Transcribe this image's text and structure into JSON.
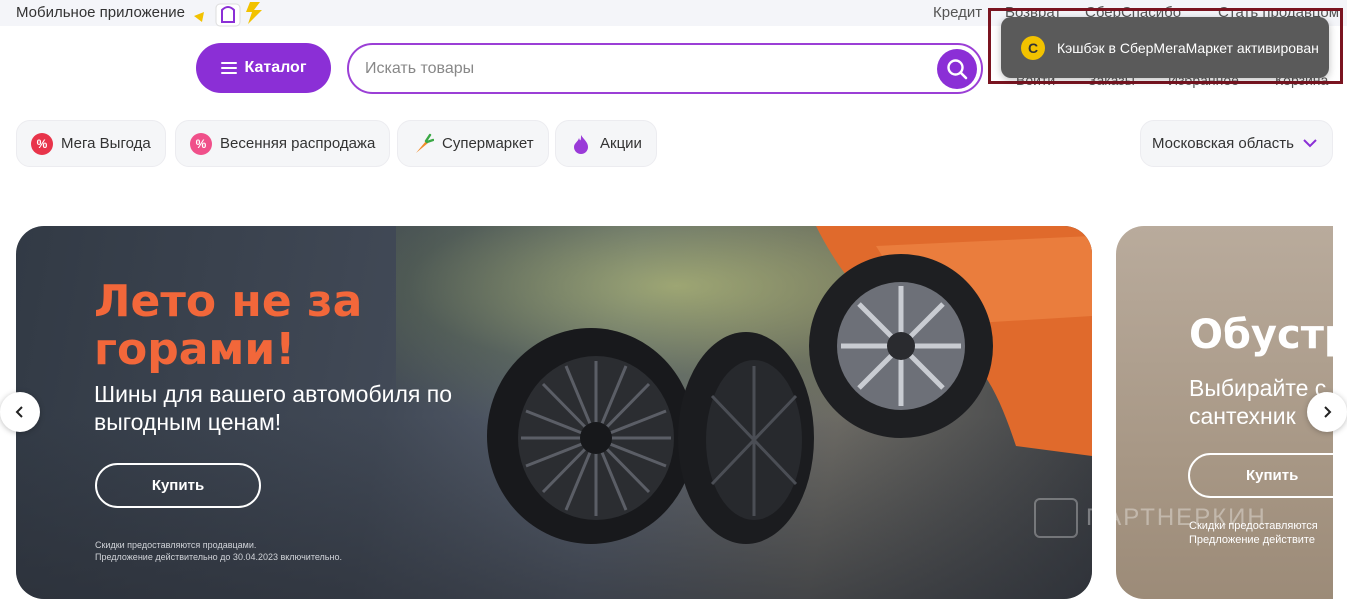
{
  "topbar": {
    "app_link": "Мобильное приложение",
    "credit": "Кредит",
    "faded_links": [
      "Возврат",
      "СберСпасибо",
      "Стать продавцом"
    ]
  },
  "header": {
    "catalog_label": "Каталог",
    "search_placeholder": "Искать товары",
    "nav": [
      "Войти",
      "Заказы",
      "Избранное",
      "Корзина"
    ]
  },
  "toast": {
    "coin": "С",
    "text": "Кэшбэк в СберМегаМаркет активирован"
  },
  "chips": [
    {
      "label": "Мега Выгода",
      "icon": "percent-icon",
      "color": "#e8344a"
    },
    {
      "label": "Весенняя распродажа",
      "icon": "flower-percent-icon",
      "color": "#f0508a"
    },
    {
      "label": "Супермаркет",
      "icon": "carrot-icon",
      "color": "#f08a28"
    },
    {
      "label": "Акции",
      "icon": "flame-icon",
      "color": "#9a3ad8"
    }
  ],
  "region": {
    "label": "Московская область"
  },
  "banner_main": {
    "title": "Лето не за горами!",
    "subtitle": "Шины для вашего автомобиля по выгодным ценам!",
    "button": "Купить",
    "fine_print_1": "Скидки предоставляются продавцами.",
    "fine_print_2": "Предложение действительно до 30.04.2023 включительно."
  },
  "banner_next": {
    "title": "Обустр",
    "subtitle_1": "Выбирайте с",
    "subtitle_2": "сантехник",
    "button": "Купить",
    "fine_print_1": "Скидки предоставляются",
    "fine_print_2": "Предложение действите"
  },
  "watermark": "ПАРТНЕРКИН",
  "colors": {
    "accent": "#8b2fd6",
    "banner_title": "#f2673a",
    "toast_bg": "#5a5a5a",
    "highlight_frame": "#7a1420"
  }
}
